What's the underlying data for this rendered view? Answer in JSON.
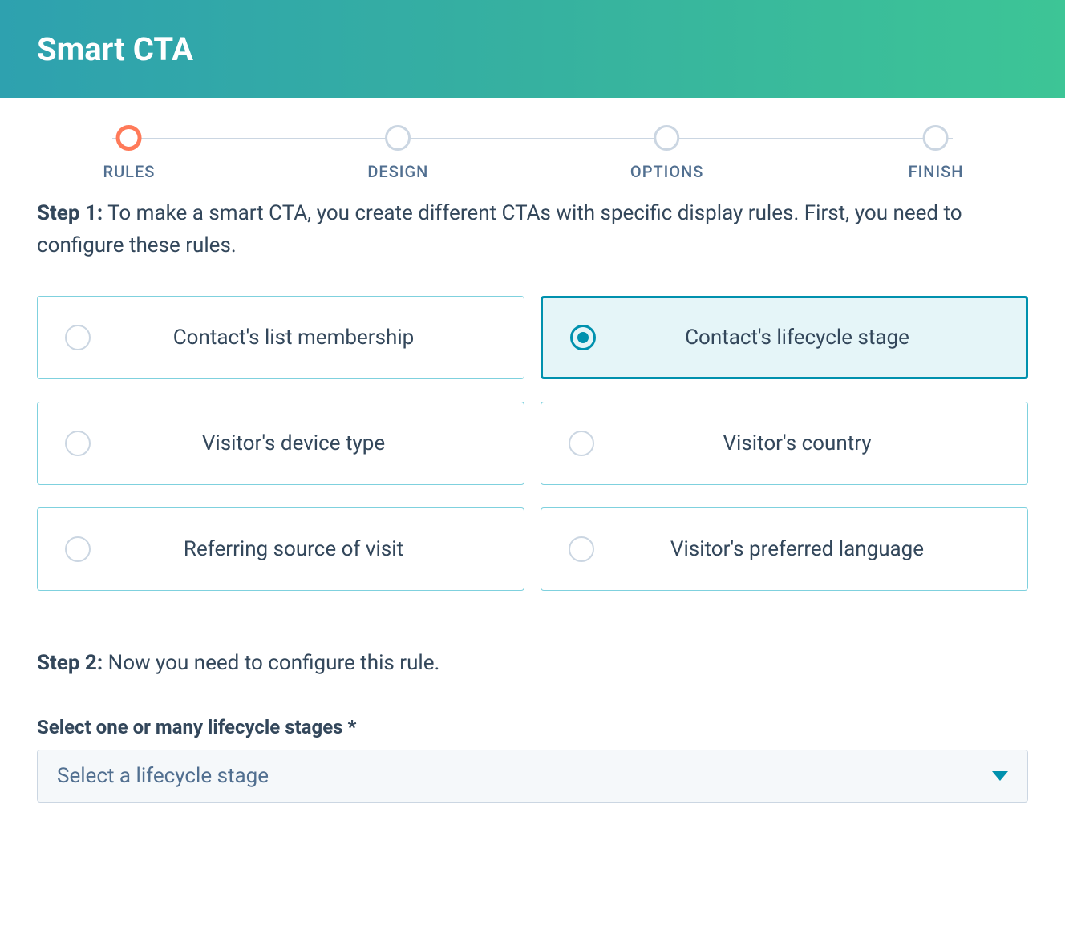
{
  "header": {
    "title": "Smart CTA"
  },
  "stepper": {
    "steps": [
      {
        "label": "RULES",
        "active": true
      },
      {
        "label": "DESIGN",
        "active": false
      },
      {
        "label": "OPTIONS",
        "active": false
      },
      {
        "label": "FINISH",
        "active": false
      }
    ]
  },
  "step1": {
    "prefix": "Step 1:",
    "text": "To make a smart CTA, you create different CTAs with specific display rules. First, you need to configure these rules."
  },
  "options": [
    {
      "label": "Contact's list membership",
      "selected": false
    },
    {
      "label": "Contact's lifecycle stage",
      "selected": true
    },
    {
      "label": "Visitor's device type",
      "selected": false
    },
    {
      "label": "Visitor's country",
      "selected": false
    },
    {
      "label": "Referring source of visit",
      "selected": false
    },
    {
      "label": "Visitor's preferred language",
      "selected": false
    }
  ],
  "step2": {
    "prefix": "Step 2:",
    "text": "Now you need to configure this rule."
  },
  "select": {
    "label": "Select one or many lifecycle stages *",
    "placeholder": "Select a lifecycle stage"
  }
}
